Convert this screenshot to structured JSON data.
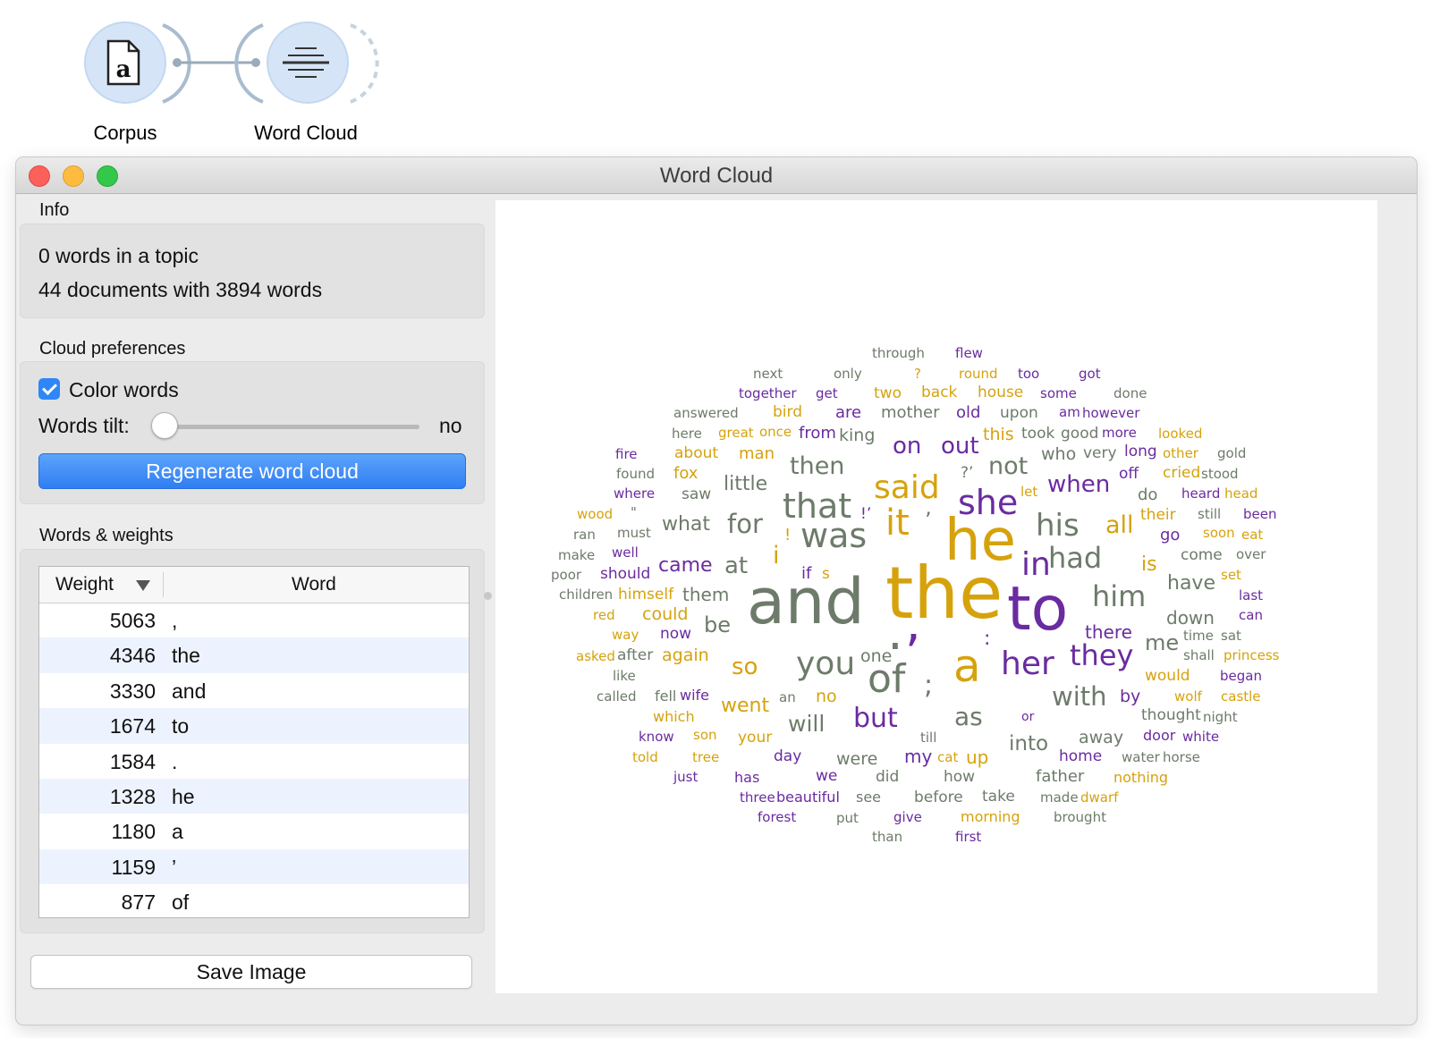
{
  "workflow": {
    "nodes": [
      {
        "label": "Corpus",
        "icon": "document-a-icon"
      },
      {
        "label": "Word Cloud",
        "icon": "word-cloud-icon"
      }
    ]
  },
  "window": {
    "title": "Word Cloud"
  },
  "info": {
    "section_title": "Info",
    "line1": "0 words in a topic",
    "line2": "44 documents with 3894 words"
  },
  "cloud_preferences": {
    "section_title": "Cloud preferences",
    "color_words_label": "Color words",
    "color_words_checked": true,
    "words_tilt_label": "Words tilt:",
    "words_tilt_value": "no",
    "regenerate_label": "Regenerate word cloud"
  },
  "words_weights": {
    "section_title": "Words & weights",
    "columns": [
      "Weight",
      "Word"
    ],
    "rows": [
      {
        "weight": "5063",
        "word": ","
      },
      {
        "weight": "4346",
        "word": "the"
      },
      {
        "weight": "3330",
        "word": "and"
      },
      {
        "weight": "1674",
        "word": "to"
      },
      {
        "weight": "1584",
        "word": "."
      },
      {
        "weight": "1328",
        "word": "he"
      },
      {
        "weight": "1180",
        "word": "a"
      },
      {
        "weight": "1159",
        "word": "’"
      },
      {
        "weight": "877",
        "word": "of"
      }
    ]
  },
  "save_image_label": "Save Image",
  "colors": {
    "gray": "#6d7b6a",
    "gold": "#d6a20c",
    "purple": "#6a2ba0"
  },
  "cloud_words": [
    "through",
    "flew",
    "next",
    "only",
    "?",
    "round",
    "too",
    "got",
    "together",
    "get",
    "two",
    "back",
    "house",
    "some",
    "done",
    "answered",
    "bird",
    "are",
    "mother",
    "old",
    "upon",
    "am",
    "however",
    "here",
    "great",
    "once",
    "from",
    "king",
    "this",
    "took",
    "good",
    "more",
    "looked",
    "fire",
    "about",
    "man",
    "on",
    "out",
    "who",
    "very",
    "long",
    "other",
    "gold",
    "found",
    "fox",
    "then",
    "not",
    "off",
    "cried",
    "stood",
    "where",
    "saw",
    "little",
    "said",
    "?’",
    "let",
    "when",
    "do",
    "heard",
    "head",
    "wood",
    "\"",
    "that",
    "she",
    "!’",
    "their",
    "still",
    "been",
    "ran",
    "must",
    "what",
    "for",
    "was",
    "it",
    "’",
    "his",
    "all",
    "go",
    "soon",
    "eat",
    "make",
    "well",
    "!",
    "he",
    "had",
    "come",
    "over",
    "poor",
    "should",
    "came",
    "at",
    "i",
    "if",
    "s",
    "in",
    "is",
    "set",
    "children",
    "himself",
    "them",
    "have",
    "last",
    "and",
    "the",
    "to",
    "him",
    "red",
    "could",
    "be",
    "down",
    "can",
    "way",
    "now",
    "there",
    "me",
    "time",
    "sat",
    "asked",
    "after",
    "again",
    "so",
    "you",
    "one",
    "her",
    "they",
    "shall",
    "princess",
    "like",
    "would",
    "began",
    "called",
    "fell",
    "wife",
    "an",
    "no",
    "of",
    ";",
    "a",
    "with",
    "by",
    "wolf",
    "castle",
    "which",
    "went",
    "as",
    "or",
    "thought",
    "night",
    "will",
    "but",
    "know",
    "son",
    "your",
    "till",
    "into",
    "away",
    "door",
    "white",
    "told",
    "tree",
    "day",
    "were",
    "my",
    "cat",
    "up",
    "home",
    "water",
    "horse",
    "just",
    "has",
    "we",
    "did",
    "how",
    "father",
    "nothing",
    "three",
    "beautiful",
    "see",
    "before",
    "take",
    "made",
    "dwarf",
    "forest",
    "put",
    "give",
    "morning",
    "brought",
    "than",
    "first",
    ",",
    ".",
    ":"
  ]
}
